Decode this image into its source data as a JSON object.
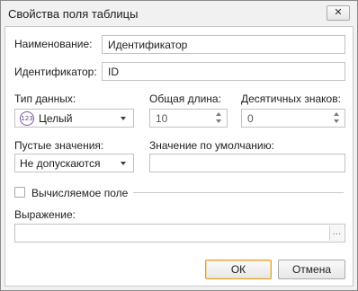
{
  "window": {
    "title": "Свойства поля таблицы",
    "close_glyph": "✕"
  },
  "form": {
    "name_label": "Наименование:",
    "name_value": "Идентификатор",
    "id_label": "Идентификатор:",
    "id_value": "ID",
    "data_type_label": "Тип данных:",
    "data_type_icon": "123",
    "data_type_value": "Целый",
    "total_length_label": "Общая длина:",
    "total_length_value": "10",
    "decimals_label": "Десятичных знаков:",
    "decimals_value": "0",
    "nulls_label": "Пустые значения:",
    "nulls_value": "Не допускаются",
    "default_label": "Значение по умолчанию:",
    "default_value": "",
    "computed_label": "Вычисляемое поле",
    "computed_checked": false,
    "expression_label": "Выражение:",
    "expression_value": "",
    "browse_glyph": "…"
  },
  "buttons": {
    "ok_label": "ОК",
    "cancel_label": "Отмена"
  },
  "colors": {
    "default_button_border": "#e0a030",
    "type_icon": "#7b5aa6"
  }
}
